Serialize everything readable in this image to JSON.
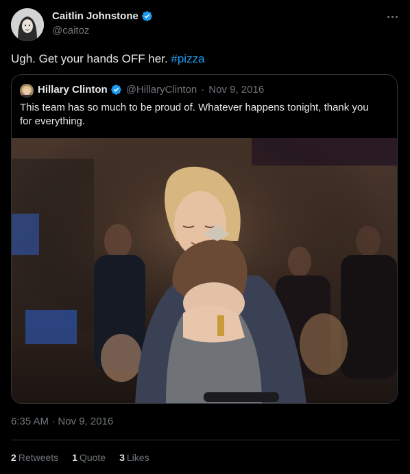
{
  "author": {
    "name": "Caitlin Johnstone",
    "handle": "@caitoz",
    "verified": true
  },
  "tweet": {
    "text": "Ugh. Get your hands OFF her. ",
    "hashtag": "#pizza",
    "timestamp": "6:35 AM · Nov 9, 2016"
  },
  "quoted_tweet": {
    "name": "Hillary Clinton",
    "handle": "@HillaryClinton",
    "separator": "·",
    "date": "Nov 9, 2016",
    "text": "This team has so much to be proud of. Whatever happens tonight, thank you for everything."
  },
  "stats": {
    "retweets_count": "2",
    "retweets_label": "Retweets",
    "quotes_count": "1",
    "quotes_label": "Quote",
    "likes_count": "3",
    "likes_label": "Likes"
  },
  "colors": {
    "background": "#000000",
    "text": "#e7e9ea",
    "secondary": "#71767b",
    "accent": "#1d9bf0",
    "border": "#2f3336"
  },
  "icons": [
    "verified-badge-icon",
    "more-options-icon"
  ]
}
